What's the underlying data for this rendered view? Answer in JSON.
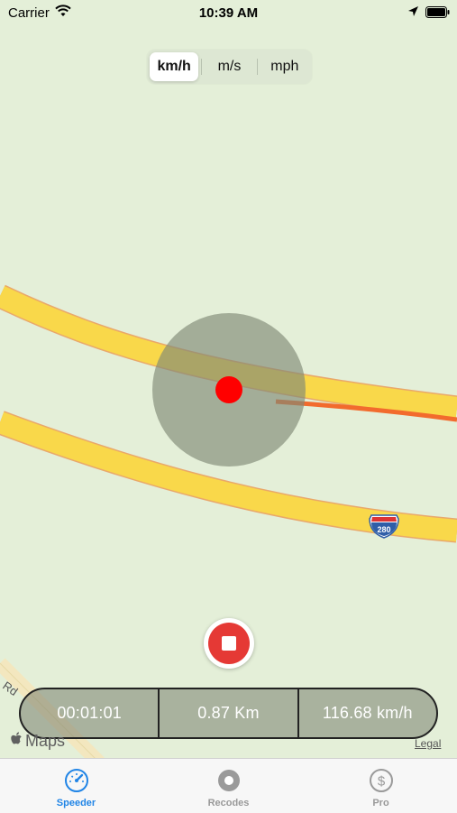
{
  "status_bar": {
    "carrier": "Carrier",
    "time": "10:39 AM"
  },
  "unit_selector": {
    "options": [
      "km/h",
      "m/s",
      "mph"
    ],
    "selected": "km/h"
  },
  "map": {
    "road_shield": "280",
    "road_label": "Rd",
    "attribution": "Maps",
    "legal": "Legal"
  },
  "stats": {
    "elapsed": "00:01:01",
    "distance": "0.87 Km",
    "speed": "116.68 km/h"
  },
  "tab_bar": {
    "items": [
      {
        "label": "Speeder",
        "icon": "speedometer-icon",
        "active": true
      },
      {
        "label": "Recodes",
        "icon": "record-icon",
        "active": false
      },
      {
        "label": "Pro",
        "icon": "dollar-icon",
        "active": false
      }
    ]
  },
  "colors": {
    "accent": "#2185e6",
    "record": "#e53935",
    "road": "#f9d84a",
    "track": "#f26b2d"
  }
}
